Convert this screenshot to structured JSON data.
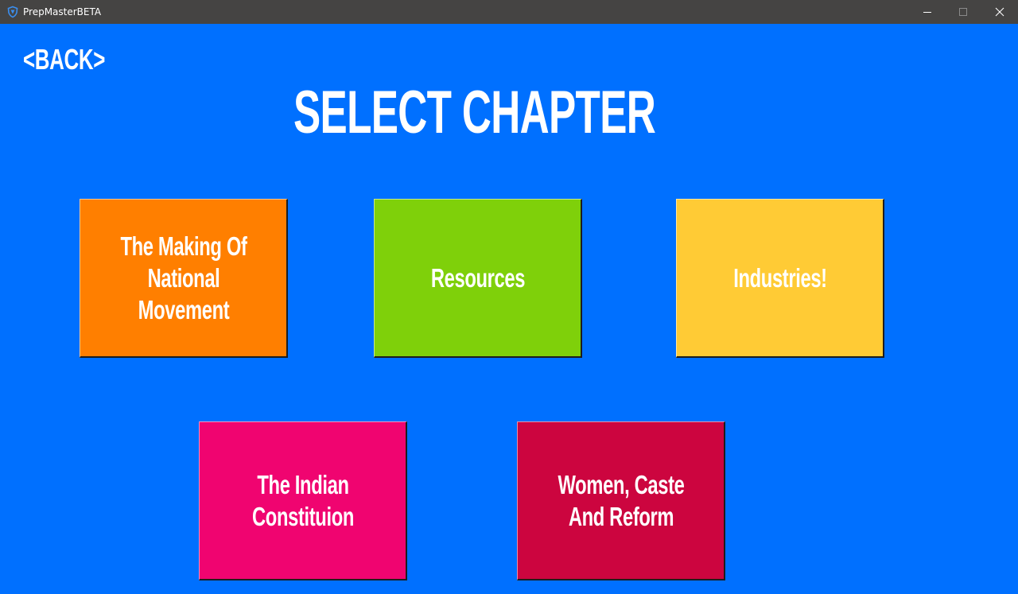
{
  "window": {
    "title": "PrepMasterBETA",
    "app_icon": "shield-icon",
    "controls": [
      "minimize-icon",
      "maximize-icon",
      "close-icon"
    ]
  },
  "nav": {
    "back_label": "<BACK>"
  },
  "page": {
    "title": "SELECT CHAPTER",
    "background": "#0070ff"
  },
  "chapters": [
    {
      "label": "The Making Of\nNational\nMovement",
      "color": "#ff7f00"
    },
    {
      "label": "Resources",
      "color": "#7fd00a"
    },
    {
      "label": "Industries!",
      "color": "#ffcb35"
    },
    {
      "label": "The Indian\nConstituion",
      "color": "#f00470"
    },
    {
      "label": "Women, Caste\nAnd Reform",
      "color": "#cc053f"
    }
  ]
}
